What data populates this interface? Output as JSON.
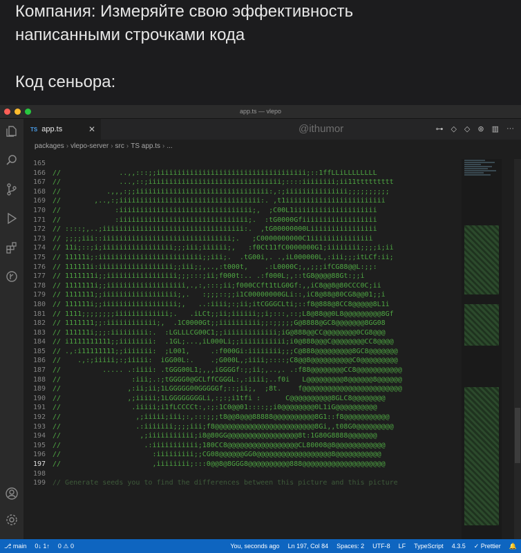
{
  "caption": {
    "line1": "Компания: Измеряйте свою эффективность",
    "line2": "написанными строчками кода",
    "line3": "Код сеньора:"
  },
  "window": {
    "title": "app.ts — vlepo",
    "traffic_colors": [
      "#fe5f57",
      "#febc2e",
      "#28c840"
    ]
  },
  "activity_icons": [
    "files-icon",
    "search-icon",
    "source-control-icon",
    "run-debug-icon",
    "extensions-icon",
    "remote-icon",
    "account-icon",
    "gear-icon"
  ],
  "tab": {
    "badge": "TS",
    "label": "app.ts",
    "close": "✕"
  },
  "watermark": "@ithumor",
  "breadcrumb": [
    "packages",
    "vlepo-server",
    "src",
    "TS app.ts",
    "..."
  ],
  "code_lines": [
    {
      "n": "165",
      "t": ""
    },
    {
      "n": "166",
      "t": "//              ..,,:::;;iiiiiiiiiiiiiiiiiiiiiiiiiiiiiiiiiiii;::1ffLLiLLLLLLLL"
    },
    {
      "n": "167",
      "t": "//              ...,::;iiiiiiiiiiiiiiiiiiiiiiiiiiiiiiii;::::iiiiiiii;ii11ttttttttt"
    },
    {
      "n": "168",
      "t": "//           .,,,:;;iiiiiiiiiiiiiiiiiiiiiiiiiiiiiiii:,:;iiiiiiiiiiiiiii;;;;;;;;;;"
    },
    {
      "n": "169",
      "t": "//        ,..,:;iiiiiiiiiiiiiiiiiiiiiiiiiiiiiiiiii:. ,t1iiiiiiiiiiiiiiiiiiiiiiii"
    },
    {
      "n": "170",
      "t": "//             :iiiiiiiiiiiiiiiiiiiiiiiiiiiiiiii;,  ;C00L1iiiiiiiiiiiiiiiiiiii"
    },
    {
      "n": "171",
      "t": "//             :iiiiiiiiiiiiiiiiiiiiiiiiiiiiiii;.  :tG0000Gfiiiiiiiiiiiiiiiiii"
    },
    {
      "n": "172",
      "t": "// ::::;,..;iiiiiiiiiiiiiiiiiiiiiiiiiiiiiiiiii:.  ,tG00000000Liiiiiiiiiiiiiiii"
    },
    {
      "n": "173",
      "t": "// ;;;;iii::iiiiiiiiiiiiiiiiiiiiiiiiiiiiiii;.   ;C0000000000C1iiiiiiiiiiiiiii"
    },
    {
      "n": "174",
      "t": "// 11i;::;i;iiiiiiiiiiiiiiiii;;;iii;iiiiii;,   :f0Ct11fC0000000G1;iiiiiiii;;;;i;ii"
    },
    {
      "n": "175",
      "t": "// 11111i;:iiiiiiiiiiiiiiiiiiiiiiiii;;iii;.  .tG00i,. .,iL000000L,:iii;;;itLCf:ii;"
    },
    {
      "n": "176",
      "t": "// 111111i:iiiiiiiiiiiiiiiiii;;iii;;,..,:t000t,    .:L0000C;,,;;;ifCG88@@L:;;:"
    },
    {
      "n": "177",
      "t": "// 1111111i;;iiiiiiiiiiiiiiiii;;;:::;ii;f000t:.. .:f000L;,::tG8@@@@88Gt:;;i"
    },
    {
      "n": "178",
      "t": "// 1111111i;;iiiiiiiiiiiiiiiiiii,.,:,:::;ii;f000CCft1tLG0Gf:,,iC8@@8@80CCC0C;ii"
    },
    {
      "n": "179",
      "t": "// 1111111;;iiiiiiiiiiiiiiiiii;,.   :;;;::;;i1C00000000GLi::,iC8@88@80CG8@@01;;i"
    },
    {
      "n": "180",
      "t": "// 111111i;;iiiiiiiiiiiiiiiiii;,   ..:iiii;:;ii;itCGGGCLti;::f8@888@8CC8@@@@@8L1i"
    },
    {
      "n": "181",
      "t": "// 1111;;;;;;;;iiiiiiiiiiiii;.   .iLCt;;ii;iiiiii;;i;:::,::;L8@88@@0L8@@@@@@@@@8Gf"
    },
    {
      "n": "182",
      "t": "// 1111111;;:iiiiiiiiiiii;,  .1C0000Gt;;iiiiiiiiii;;:;;;;;G@8888@GC8@@@@@@@8GG08"
    },
    {
      "n": "183",
      "t": "// 111111i;;;:iiiiiiiii:.  :LGLLLCG00C1;;iiiiiiiiiiiii;iG@888@@CC@@@@@@@@0CG8@@@"
    },
    {
      "n": "184",
      "t": "// i1111111111;;iiiiiiii:  .1GL;...,iL000Li;;iiiiiiiiiii;i0@888@@@C@@@@@@@@CC8@@@@"
    },
    {
      "n": "185",
      "t": "// .,:i11111111;;iiiiiii:  ;L001,     .:f000Gi:iiiiiiii;;;C@888@@@@@@@@@8GC8@@@@@@@"
    },
    {
      "n": "186",
      "t": "//    .,:;iiiii;:;iiiii:  iGG00L:.    .;G000L,;iiii;::::;C8@@8@@@@@@@@@@C0@@@@@@@@@"
    },
    {
      "n": "187",
      "t": "//          ..... .:iiii: .tGGG00L1;,,,iGGGGf:;;ii;,..,. .:f88@@@@@@@@CC8@@@@@@@@@@@"
    },
    {
      "n": "188",
      "t": "//                 :iii;.:;tGGGG0@GCLffCGGGL:,:iiii;..f0i   L@@@@@@@@@8@@@@@@8@@@@@@"
    },
    {
      "n": "189",
      "t": "//                ,:ii;ii;1LGGGGG00GGGGGf;::;ii;,  ;8t.    f@@@@@@@@@@@@@@@@@@@@@@@@"
    },
    {
      "n": "190",
      "t": "//                ,;iiiii;1LGGGGGGGGLi,:;:;i1tfi :      C@@@@@@@@@@8GLC8@@@@@@@@"
    },
    {
      "n": "191",
      "t": "//                 .iiiii;i1fLCCCCt:,:;:1C0@@01::::;;i0@@@@@@@@0L1iG@@@@@@@@@@"
    },
    {
      "n": "192",
      "t": "//                  ,;iiiii;iii;:,:::;;;t8@@8@@@88888@@@@@@@@@@8G1::f8@@@@@@@@@@@"
    },
    {
      "n": "193",
      "t": "//                  .:iiiiiii;;;;iii;f8@@@@@@@@@@@@@@@@@@@@@@@@8Gi,,t08G0@@@@@@@@@"
    },
    {
      "n": "194",
      "t": "//                   ,;iiiiiiiiiii;i8@80GG@@@@@@@@@@@@@@@@@8t:1G80G8888@@@@@@@"
    },
    {
      "n": "195",
      "t": "//                    .:iiiiiiiiiii;180CC8@@@@@@@@@@@@@@@@@CL80008@8@@@@@@@@@@@@"
    },
    {
      "n": "196",
      "t": "//                      :iiiiiiiii;;CG08@@@@@@GG0@@@@@@@@@@@@@@@@@@8@@@@@@@@@@@"
    },
    {
      "n": "197",
      "t": "//                      ,iiiiiiii;:::0@@8@8GGG8@@@@@@@@@@888@@@@@@@@@@@@@@@@@@@@"
    },
    {
      "n": "198",
      "t": ""
    },
    {
      "n": "199",
      "t": "// Generate seeds you to find the differences between this picture and this picture"
    }
  ],
  "current_line": "197",
  "status": {
    "branch": "main",
    "sync": "0↓ 1↑",
    "problems": "0 ⚠ 0",
    "blame": "You, seconds ago",
    "position": "Ln 197, Col 84",
    "spaces": "Spaces: 2",
    "encoding": "UTF-8",
    "eol": "LF",
    "language": "TypeScript",
    "version": "4.3.5",
    "prettier": "✓ Prettier"
  }
}
